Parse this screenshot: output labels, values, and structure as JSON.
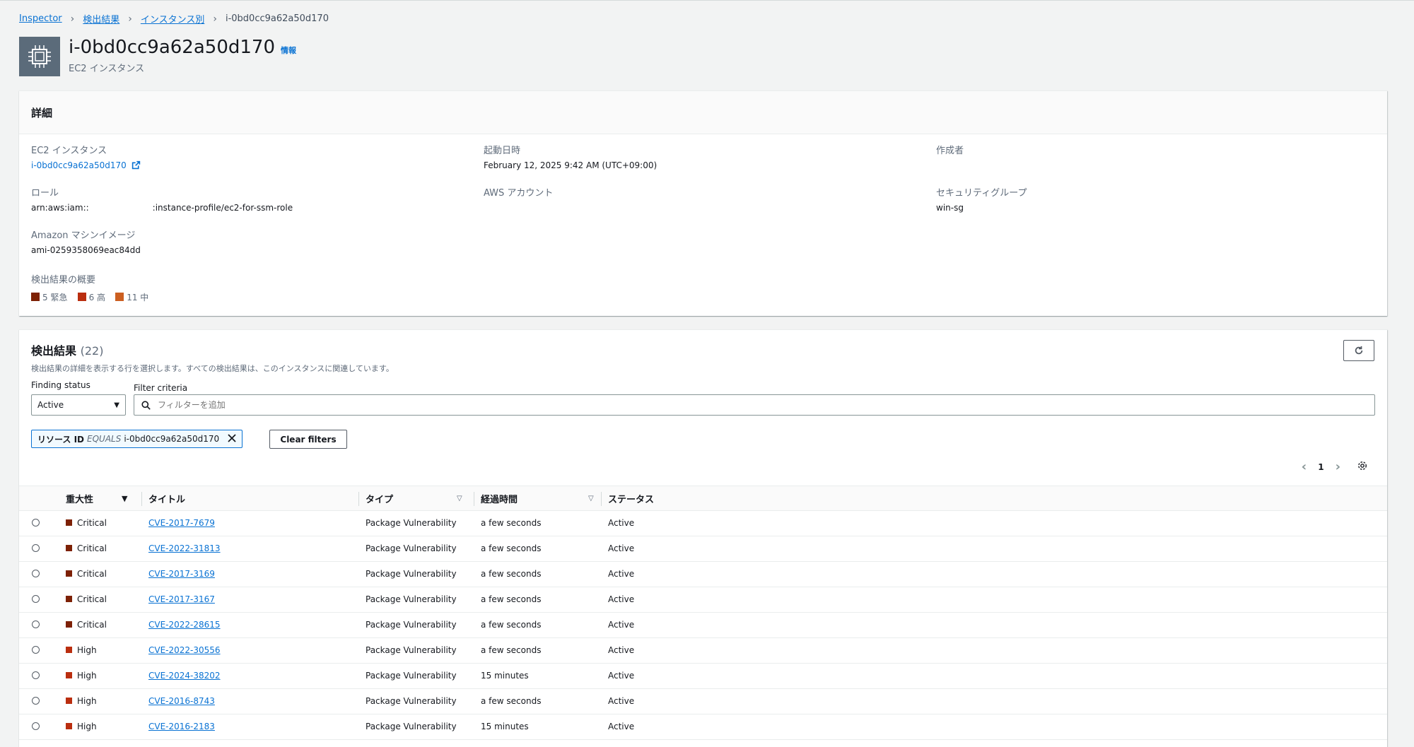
{
  "breadcrumb": {
    "root": "Inspector",
    "findings": "検出結果",
    "by_instance": "インスタンス別",
    "current": "i-0bd0cc9a62a50d170"
  },
  "header": {
    "title": "i-0bd0cc9a62a50d170",
    "info": "情報",
    "subtitle": "EC2 インスタンス"
  },
  "details": {
    "heading": "詳細",
    "ec2_label": "EC2 インスタンス",
    "ec2_value": "i-0bd0cc9a62a50d170",
    "launch_label": "起動日時",
    "launch_value": "February 12, 2025 9:42 AM (UTC+09:00)",
    "creator_label": "作成者",
    "role_label": "ロール",
    "role_value_prefix": "arn:aws:iam::",
    "role_value_suffix": ":instance-profile/ec2-for-ssm-role",
    "account_label": "AWS アカウント",
    "sg_label": "セキュリティグループ",
    "sg_value": "win-sg",
    "ami_label": "Amazon マシンイメージ",
    "ami_value": "ami-0259358069eac84dd",
    "summary_label": "検出結果の概要",
    "summary": [
      {
        "text": "5 緊急",
        "color": "#7d2105"
      },
      {
        "text": "6 高",
        "color": "#ba2e0f"
      },
      {
        "text": "11 中",
        "color": "#cc5f21"
      }
    ]
  },
  "findings": {
    "title": "検出結果",
    "count": "(22)",
    "description": "検出結果の詳細を表示する行を選択します。すべての検出結果は、このインスタンスに関連しています。",
    "status_label": "Finding status",
    "status_value": "Active",
    "filter_label": "Filter criteria",
    "filter_placeholder": "フィルターを追加",
    "token_key": "リソース ID",
    "token_op": "EQUALS",
    "token_value": "i-0bd0cc9a62a50d170",
    "clear_filters": "Clear filters",
    "page": "1",
    "columns": {
      "severity": "重大性",
      "title": "タイトル",
      "type": "タイプ",
      "age": "経過時間",
      "status": "ステータス"
    },
    "rows": [
      {
        "severity": "Critical",
        "color": "#7d2105",
        "title": "CVE-2017-7679",
        "type": "Package Vulnerability",
        "age": "a few seconds",
        "status": "Active"
      },
      {
        "severity": "Critical",
        "color": "#7d2105",
        "title": "CVE-2022-31813",
        "type": "Package Vulnerability",
        "age": "a few seconds",
        "status": "Active"
      },
      {
        "severity": "Critical",
        "color": "#7d2105",
        "title": "CVE-2017-3169",
        "type": "Package Vulnerability",
        "age": "a few seconds",
        "status": "Active"
      },
      {
        "severity": "Critical",
        "color": "#7d2105",
        "title": "CVE-2017-3167",
        "type": "Package Vulnerability",
        "age": "a few seconds",
        "status": "Active"
      },
      {
        "severity": "Critical",
        "color": "#7d2105",
        "title": "CVE-2022-28615",
        "type": "Package Vulnerability",
        "age": "a few seconds",
        "status": "Active"
      },
      {
        "severity": "High",
        "color": "#ba2e0f",
        "title": "CVE-2022-30556",
        "type": "Package Vulnerability",
        "age": "a few seconds",
        "status": "Active"
      },
      {
        "severity": "High",
        "color": "#ba2e0f",
        "title": "CVE-2024-38202",
        "type": "Package Vulnerability",
        "age": "15 minutes",
        "status": "Active"
      },
      {
        "severity": "High",
        "color": "#ba2e0f",
        "title": "CVE-2016-8743",
        "type": "Package Vulnerability",
        "age": "a few seconds",
        "status": "Active"
      },
      {
        "severity": "High",
        "color": "#ba2e0f",
        "title": "CVE-2016-2183",
        "type": "Package Vulnerability",
        "age": "15 minutes",
        "status": "Active"
      }
    ]
  }
}
